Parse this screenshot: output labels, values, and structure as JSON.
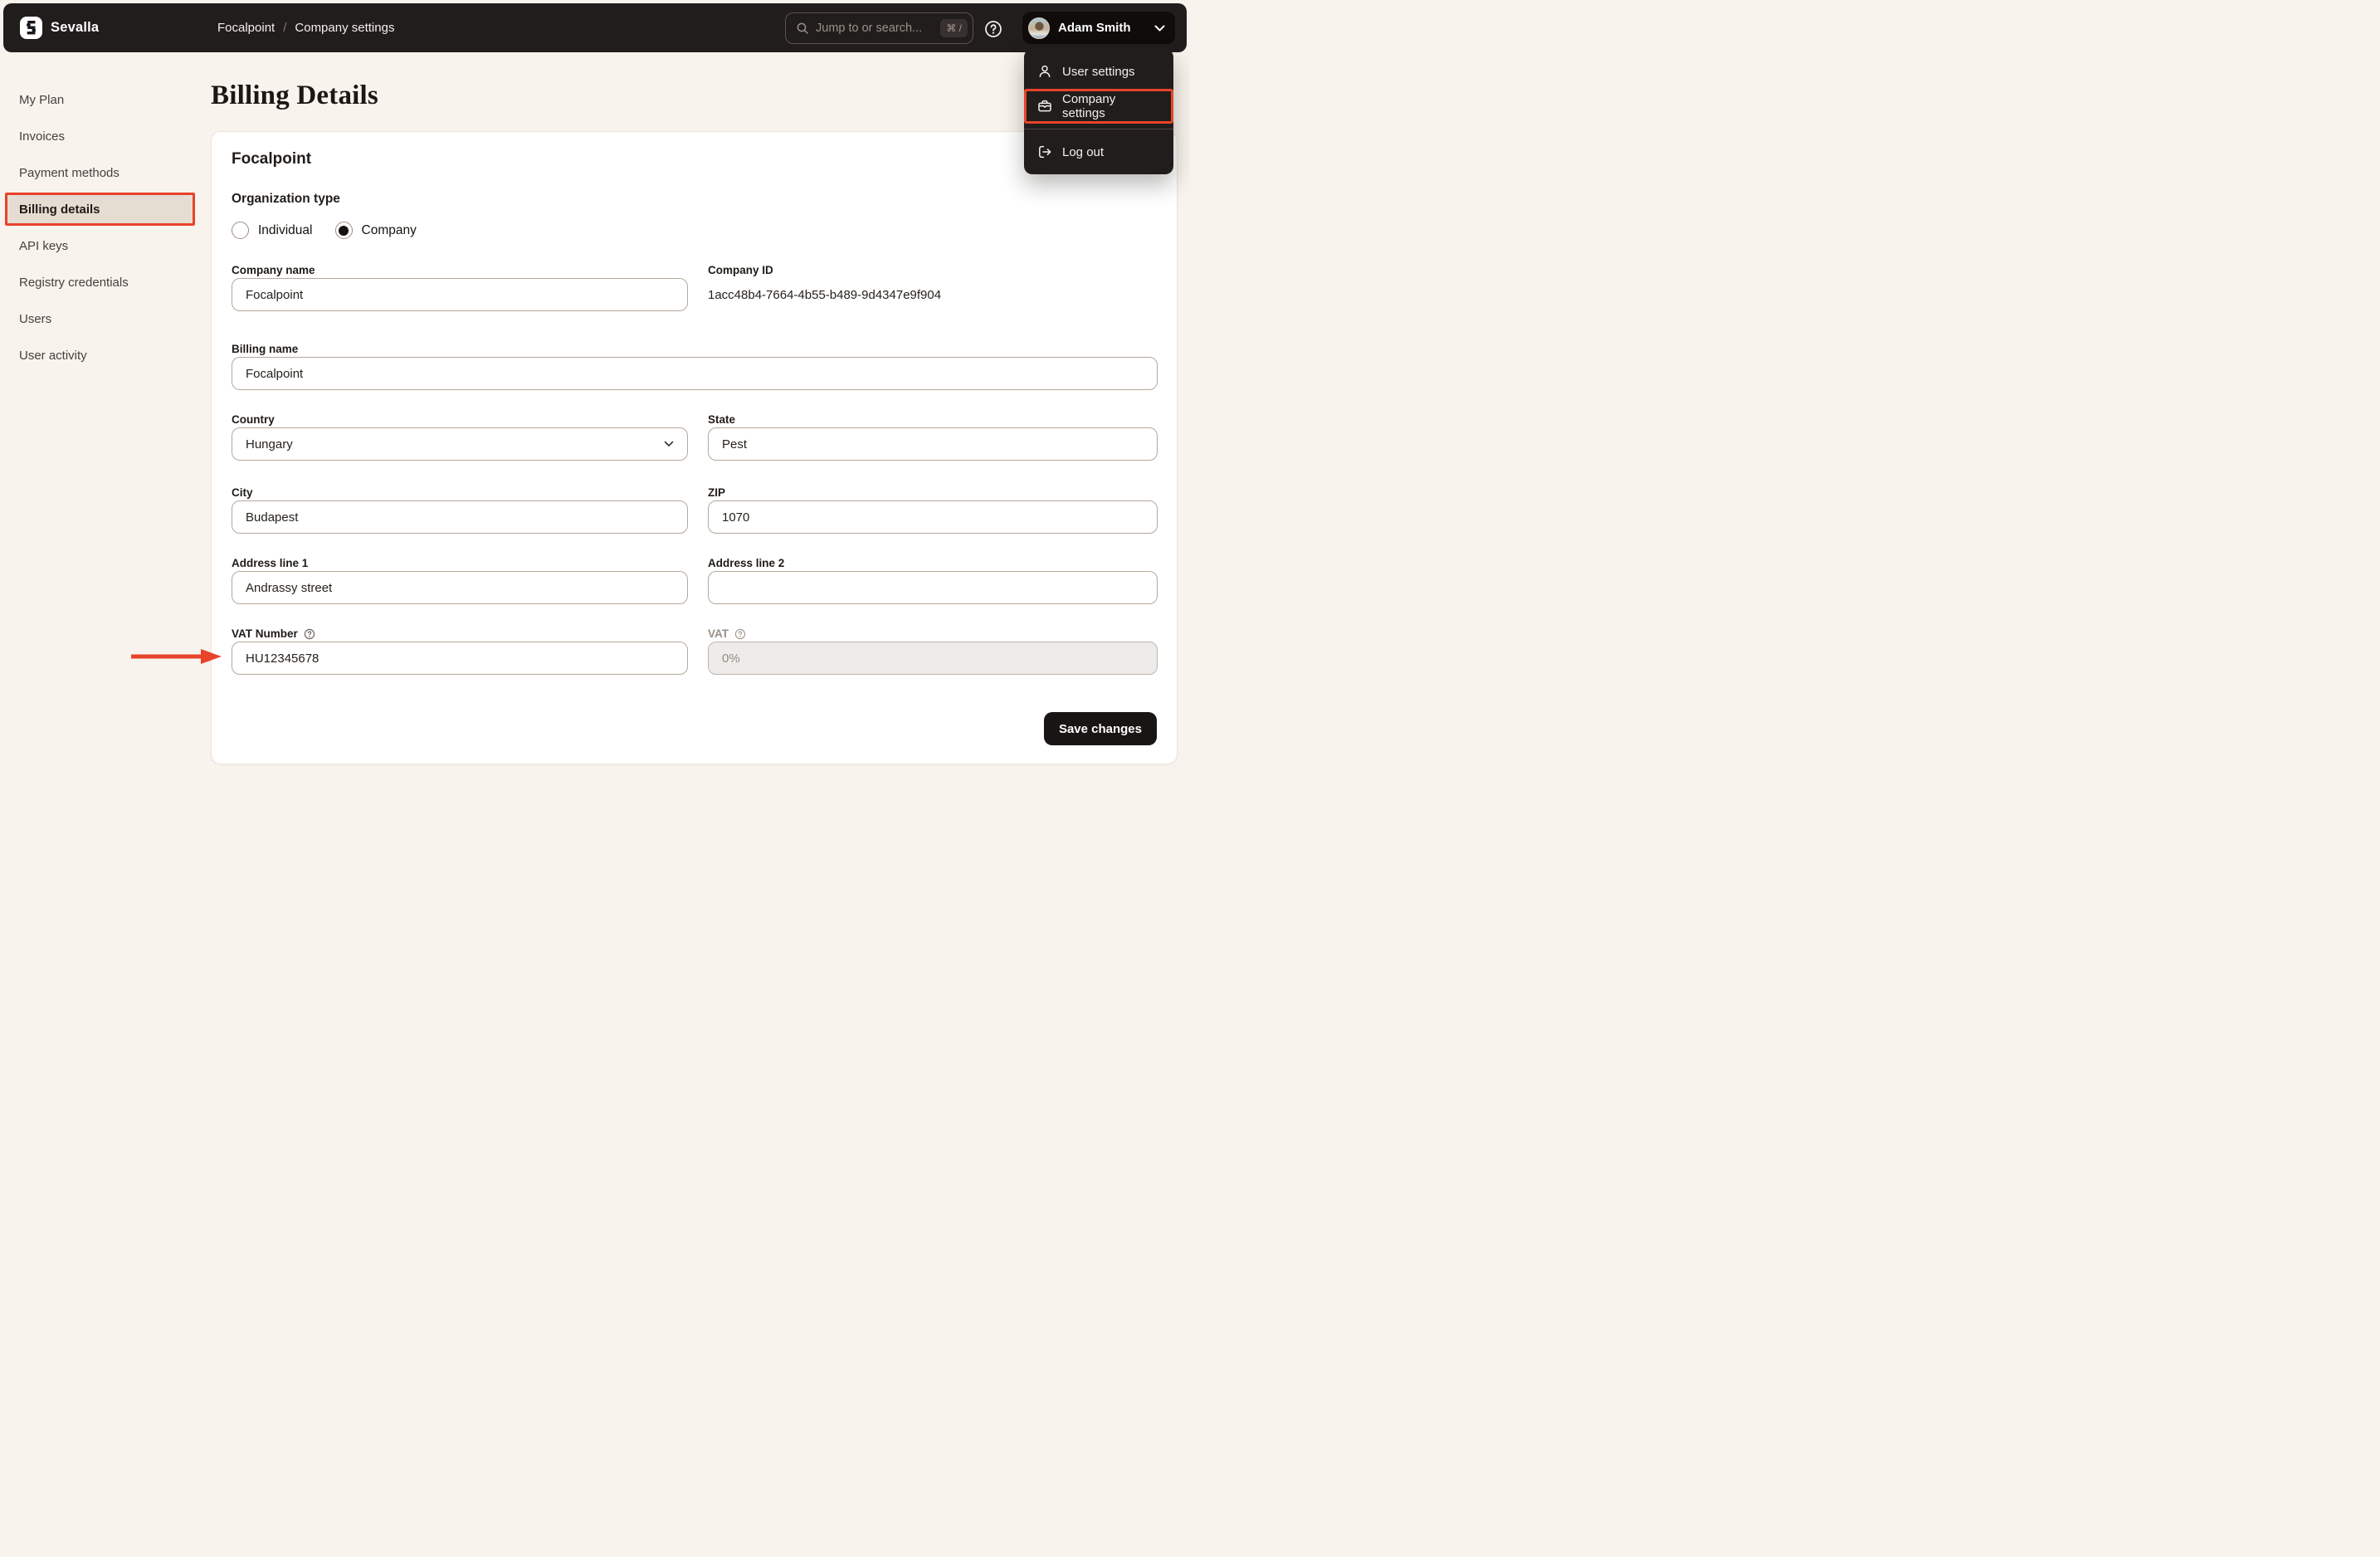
{
  "topbar": {
    "brand": "Sevalla",
    "breadcrumb": {
      "parent": "Focalpoint",
      "separator": "/",
      "current": "Company settings"
    },
    "search": {
      "placeholder": "Jump to or search...",
      "shortcut": "⌘ /"
    },
    "user": {
      "name": "Adam Smith"
    }
  },
  "user_menu": {
    "items": [
      {
        "label": "User settings",
        "icon": "user-icon",
        "highlighted": false
      },
      {
        "label": "Company settings",
        "icon": "briefcase-icon",
        "highlighted": true
      },
      {
        "label": "Log out",
        "icon": "logout-icon",
        "highlighted": false
      }
    ]
  },
  "sidebar": {
    "active_index": 3,
    "items": [
      {
        "label": "My Plan"
      },
      {
        "label": "Invoices"
      },
      {
        "label": "Payment methods"
      },
      {
        "label": "Billing details"
      },
      {
        "label": "API keys"
      },
      {
        "label": "Registry credentials"
      },
      {
        "label": "Users"
      },
      {
        "label": "User activity"
      }
    ]
  },
  "page": {
    "title": "Billing Details"
  },
  "card": {
    "company_title": "Focalpoint",
    "organization_type": {
      "label": "Organization type",
      "options": [
        {
          "label": "Individual",
          "selected": false
        },
        {
          "label": "Company",
          "selected": true
        }
      ]
    },
    "company_name": {
      "label": "Company name",
      "value": "Focalpoint"
    },
    "company_id": {
      "label": "Company ID",
      "value": "1acc48b4-7664-4b55-b489-9d4347e9f904"
    },
    "billing_name": {
      "label": "Billing name",
      "value": "Focalpoint"
    },
    "country": {
      "label": "Country",
      "value": "Hungary"
    },
    "state": {
      "label": "State",
      "value": "Pest"
    },
    "city": {
      "label": "City",
      "value": "Budapest"
    },
    "zip": {
      "label": "ZIP",
      "value": "1070"
    },
    "address1": {
      "label": "Address line 1",
      "value": "Andrassy street"
    },
    "address2": {
      "label": "Address line 2",
      "value": ""
    },
    "vat_number": {
      "label": "VAT Number",
      "value": "HU12345678"
    },
    "vat": {
      "label": "VAT",
      "value": "0%",
      "disabled": true
    },
    "save_label": "Save changes"
  },
  "colors": {
    "accent_red": "#e8432b",
    "topbar_bg": "#211d1c",
    "page_bg": "#f8f3ed",
    "card_bg": "#ffffff",
    "input_border": "#b5a89b",
    "active_item_bg": "#e5dcd2"
  }
}
